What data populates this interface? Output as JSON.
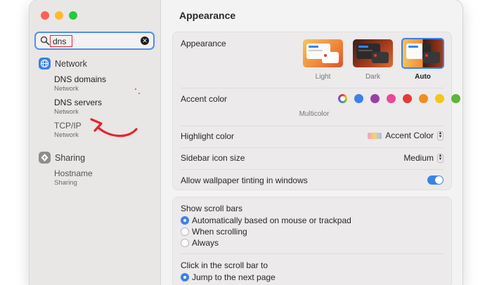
{
  "sidebar": {
    "search": {
      "value": "dns"
    },
    "sections": [
      {
        "name": "Network",
        "icon": "globe-icon",
        "results": [
          {
            "title": "DNS domains",
            "subtitle": "Network"
          },
          {
            "title": "DNS servers",
            "subtitle": "Network"
          },
          {
            "title": "TCP/IP",
            "subtitle": "Network"
          }
        ]
      },
      {
        "name": "Sharing",
        "icon": "sharing-icon",
        "results": [
          {
            "title": "Hostname",
            "subtitle": "Sharing"
          }
        ]
      }
    ]
  },
  "main": {
    "title": "Appearance",
    "appearance": {
      "label": "Appearance",
      "options": [
        {
          "label": "Light",
          "selected": false
        },
        {
          "label": "Dark",
          "selected": false
        },
        {
          "label": "Auto",
          "selected": true
        }
      ]
    },
    "accent": {
      "label": "Accent color",
      "caption": "Multicolor",
      "colors": [
        "multicolor",
        "#3b82e6",
        "#9b3ea8",
        "#e8479a",
        "#e53935",
        "#f28c1f",
        "#f5c518",
        "#5cb837",
        "#8e8e8e"
      ]
    },
    "highlight": {
      "label": "Highlight color",
      "value": "Accent Color"
    },
    "sidebar_icon": {
      "label": "Sidebar icon size",
      "value": "Medium"
    },
    "wallpaper": {
      "label": "Allow wallpaper tinting in windows",
      "enabled": true
    },
    "scroll": {
      "label": "Show scroll bars",
      "options": [
        {
          "label": "Automatically based on mouse or trackpad",
          "selected": true
        },
        {
          "label": "When scrolling",
          "selected": false
        },
        {
          "label": "Always",
          "selected": false
        }
      ]
    },
    "click": {
      "label": "Click in the scroll bar to",
      "options": [
        {
          "label": "Jump to the next page",
          "selected": true
        }
      ]
    }
  },
  "colors": {
    "accent": "#3b82e6",
    "annotation": "#e2272a"
  }
}
